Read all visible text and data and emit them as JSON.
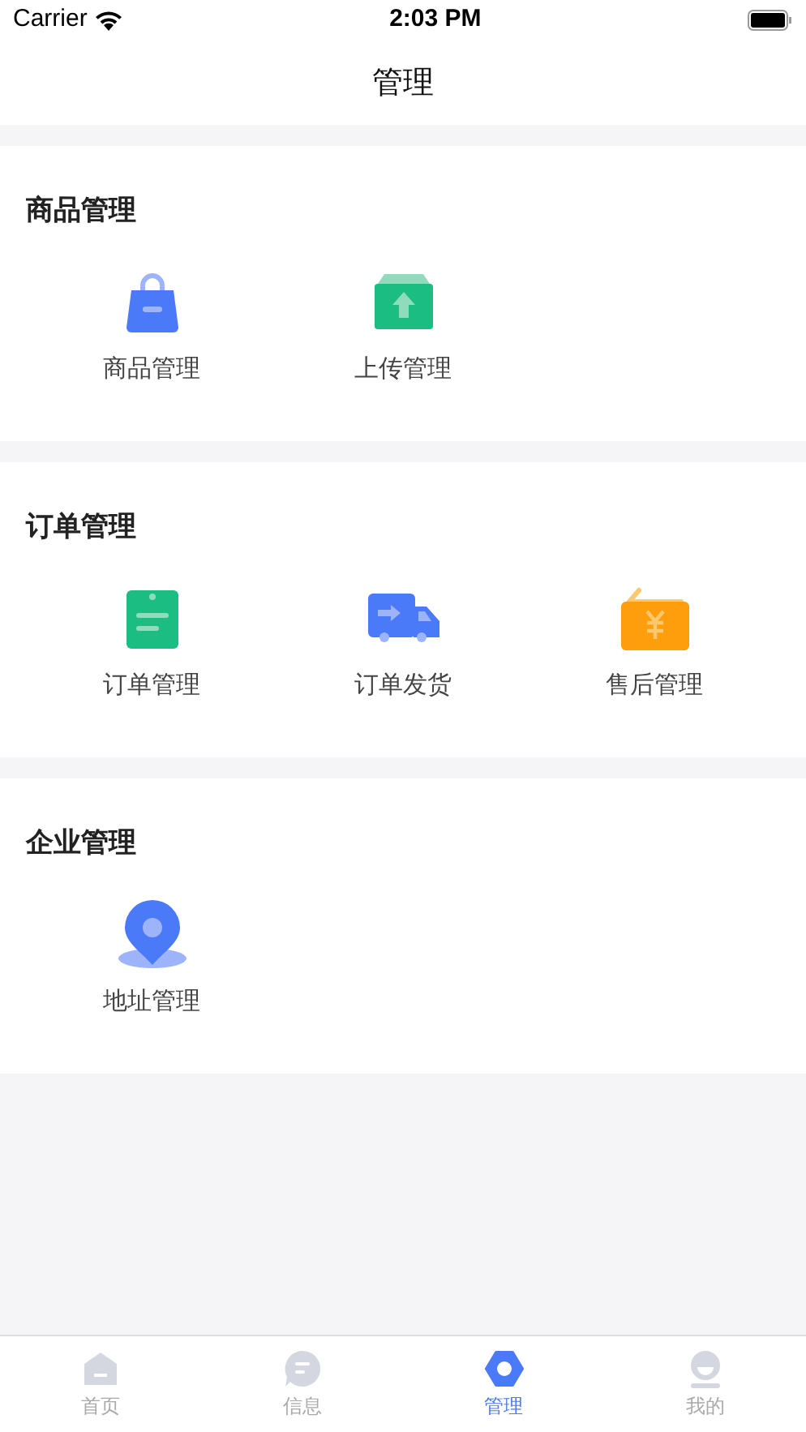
{
  "status_bar": {
    "carrier": "Carrier",
    "time": "2:03 PM"
  },
  "nav": {
    "title": "管理"
  },
  "sections": [
    {
      "title": "商品管理",
      "items": [
        {
          "kind": "bag",
          "label": "商品管理"
        },
        {
          "kind": "upload",
          "label": "上传管理"
        }
      ]
    },
    {
      "title": "订单管理",
      "items": [
        {
          "kind": "clipboard",
          "label": "订单管理"
        },
        {
          "kind": "truck",
          "label": "订单发货"
        },
        {
          "kind": "refund",
          "label": "售后管理"
        }
      ]
    },
    {
      "title": "企业管理",
      "items": [
        {
          "kind": "location",
          "label": "地址管理"
        }
      ]
    }
  ],
  "tab_bar": [
    {
      "kind": "home",
      "label": "首页",
      "selected": false
    },
    {
      "kind": "message",
      "label": "信息",
      "selected": false
    },
    {
      "kind": "manage",
      "label": "管理",
      "selected": true
    },
    {
      "kind": "profile",
      "label": "我的",
      "selected": false
    }
  ]
}
